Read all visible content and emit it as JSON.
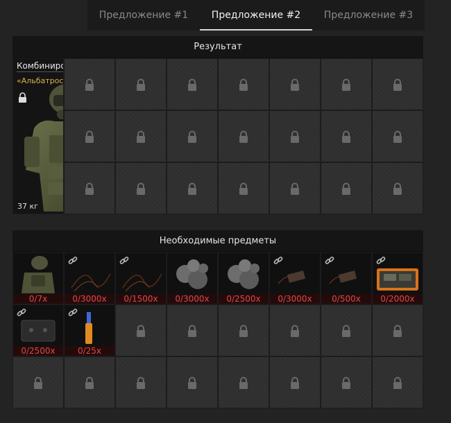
{
  "tabs": [
    {
      "label": "Предложение #1",
      "active": false
    },
    {
      "label": "Предложение #2",
      "active": true
    },
    {
      "label": "Предложение #3",
      "active": false
    }
  ],
  "result": {
    "header": "Результат",
    "item": {
      "name": "Комбинированные",
      "subtitle": "«Альбатрос-Штурмовик...",
      "weight": "37 кг",
      "icon": "armor-suit-icon",
      "locked": true
    }
  },
  "required": {
    "header": "Необходимые предметы",
    "items": [
      {
        "icon": "armor-suit-icon",
        "qty": "0/7x",
        "linked": false
      },
      {
        "icon": "wire-material-icon",
        "qty": "0/3000x",
        "linked": true
      },
      {
        "icon": "wire-material-icon",
        "qty": "0/1500x",
        "linked": true
      },
      {
        "icon": "ore-rocks-icon",
        "qty": "0/3000x",
        "linked": false
      },
      {
        "icon": "ore-rocks-icon",
        "qty": "0/2500x",
        "linked": false
      },
      {
        "icon": "circuit-part-icon",
        "qty": "0/3000x",
        "linked": true
      },
      {
        "icon": "circuit-part-icon",
        "qty": "0/500x",
        "linked": true
      },
      {
        "icon": "circuit-board-icon",
        "qty": "0/2000x",
        "linked": true
      },
      {
        "icon": "metal-plate-icon",
        "qty": "0/2500x",
        "linked": true
      },
      {
        "icon": "tool-vial-icon",
        "qty": "0/25x",
        "linked": true
      }
    ]
  },
  "colors": {
    "accent_gold": "#d7b24a",
    "missing_red": "#e04848",
    "background": "#232323"
  }
}
